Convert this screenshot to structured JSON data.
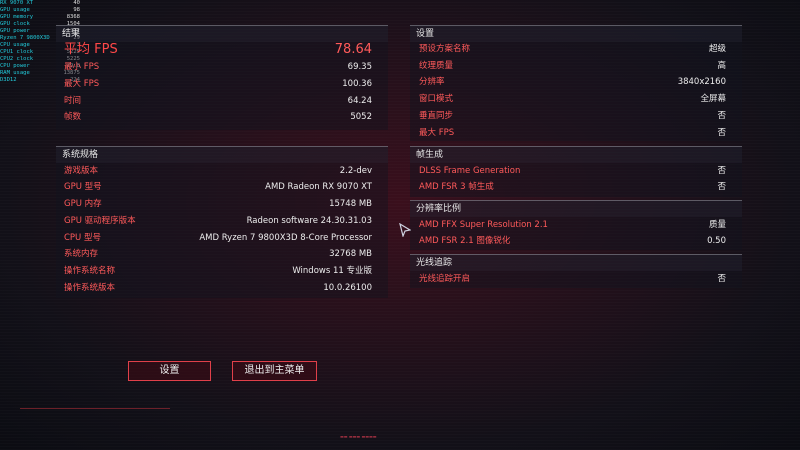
{
  "overlay": [
    {
      "label": "RX 9070 XT",
      "value": "40"
    },
    {
      "label": "GPU usage",
      "value": "98"
    },
    {
      "label": "GPU memory",
      "value": "8368"
    },
    {
      "label": "GPU clock",
      "value": "1504"
    },
    {
      "label": "GPU power",
      "value": "172"
    },
    {
      "label": "Ryzen 7 9800X3D",
      "value": "29"
    },
    {
      "label": "CPU usage",
      "value": "3"
    },
    {
      "label": "CPU1 clock",
      "value": "5225"
    },
    {
      "label": "CPU2 clock",
      "value": "5225"
    },
    {
      "label": "CPU power",
      "value": "79.8"
    },
    {
      "label": "RAM usage",
      "value": "13875"
    },
    {
      "label": "D3D12",
      "value": "224"
    }
  ],
  "results": {
    "title": "结果",
    "avg_fps_label": "平均 FPS",
    "avg_fps_value": "78.64",
    "rows": [
      {
        "label": "最小 FPS",
        "value": "69.35"
      },
      {
        "label": "最大 FPS",
        "value": "100.36"
      },
      {
        "label": "时间",
        "value": "64.24"
      },
      {
        "label": "帧数",
        "value": "5052"
      }
    ]
  },
  "system": {
    "title": "系统规格",
    "rows": [
      {
        "label": "游戏版本",
        "value": "2.2-dev"
      },
      {
        "label": "GPU 型号",
        "value": "AMD Radeon RX 9070 XT"
      },
      {
        "label": "GPU 内存",
        "value": "15748 MB"
      },
      {
        "label": "GPU 驱动程序版本",
        "value": "Radeon software 24.30.31.03"
      },
      {
        "label": "CPU 型号",
        "value": "AMD Ryzen 7 9800X3D 8-Core Processor"
      },
      {
        "label": "系统内存",
        "value": "32768 MB"
      },
      {
        "label": "操作系统名称",
        "value": "Windows 11 专业版"
      },
      {
        "label": "操作系统版本",
        "value": "10.0.26100"
      }
    ]
  },
  "settings": {
    "title": "设置",
    "rows": [
      {
        "label": "预设方案名称",
        "value": "超级"
      },
      {
        "label": "纹理质量",
        "value": "高"
      },
      {
        "label": "分辨率",
        "value": "3840x2160"
      },
      {
        "label": "窗口模式",
        "value": "全屏幕"
      },
      {
        "label": "垂直同步",
        "value": "否"
      },
      {
        "label": "最大 FPS",
        "value": "否"
      }
    ]
  },
  "framegen": {
    "title": "帧生成",
    "rows": [
      {
        "label": "DLSS Frame Generation",
        "value": "否"
      },
      {
        "label": "AMD FSR 3 帧生成",
        "value": "否"
      }
    ]
  },
  "resolution_scale": {
    "title": "分辨率比例",
    "rows": [
      {
        "label": "AMD FFX Super Resolution 2.1",
        "value": "质量"
      },
      {
        "label": "AMD FSR 2.1 图像锐化",
        "value": "0.50"
      }
    ]
  },
  "raytracing": {
    "title": "光线追踪",
    "rows": [
      {
        "label": "光线追踪开启",
        "value": "否"
      }
    ]
  },
  "buttons": {
    "settings": "设置",
    "exit": "退出到主菜单"
  },
  "colors": {
    "accent_red": "#ff5a5a",
    "value_white": "#ededed",
    "overlay_cyan": "#22c8d8"
  }
}
